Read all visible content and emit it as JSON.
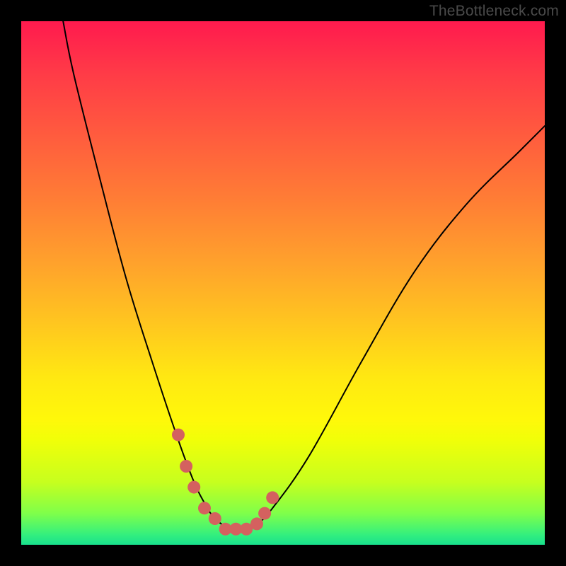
{
  "watermark": "TheBottleneck.com",
  "chart_data": {
    "type": "line",
    "title": "",
    "xlabel": "",
    "ylabel": "",
    "xlim": [
      0,
      100
    ],
    "ylim": [
      0,
      100
    ],
    "grid": false,
    "series": [
      {
        "name": "curve",
        "x": [
          8,
          10,
          15,
          20,
          25,
          30,
          33,
          35,
          37,
          40,
          42,
          45,
          48,
          55,
          65,
          75,
          85,
          95,
          100
        ],
        "y": [
          100,
          90,
          70,
          51,
          35,
          20,
          12,
          8,
          5,
          3,
          3,
          4,
          7,
          17,
          35,
          52,
          65,
          75,
          80
        ]
      }
    ],
    "scatter_points": {
      "name": "highlight-dots",
      "color": "#d4615f",
      "x": [
        30,
        31.5,
        33,
        35,
        37,
        39,
        41,
        43,
        45,
        46.5,
        48
      ],
      "y": [
        21,
        15,
        11,
        7,
        5,
        3,
        3,
        3,
        4,
        6,
        9
      ]
    },
    "gradient_background": {
      "orientation": "vertical",
      "stops": [
        {
          "pos": 0,
          "color": "#ff1a4e"
        },
        {
          "pos": 46,
          "color": "#ffa12c"
        },
        {
          "pos": 76,
          "color": "#fff80a"
        },
        {
          "pos": 100,
          "color": "#18e08d"
        }
      ]
    }
  }
}
